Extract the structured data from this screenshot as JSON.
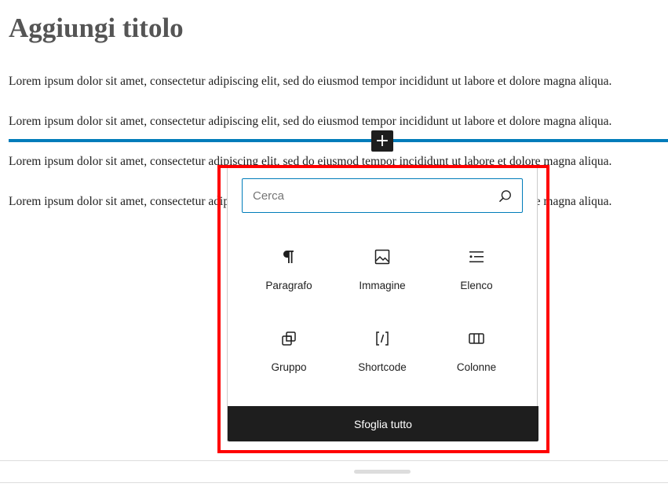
{
  "editor": {
    "title": "Aggiungi titolo",
    "paragraphs": [
      "Lorem ipsum dolor sit amet, consectetur adipiscing elit, sed do eiusmod tempor incididunt ut labore et dolore magna aliqua.",
      "Lorem ipsum dolor sit amet, consectetur adipiscing elit, sed do eiusmod tempor incididunt ut labore et dolore magna aliqua.",
      "Lorem ipsum dolor sit amet, consectetur adipiscing elit, sed do eiusmod tempor incididunt ut labore et dolore magna aliqua.",
      "Lorem ipsum dolor sit amet, consectetur adipiscing elit, sed do eiusmod tempor incididunt ut labore et dolore magna aliqua."
    ],
    "inserter_toggle": "+"
  },
  "inserter": {
    "search": {
      "placeholder": "Cerca",
      "value": ""
    },
    "blocks": [
      {
        "label": "Paragrafo",
        "icon": "paragraph-icon"
      },
      {
        "label": "Immagine",
        "icon": "image-icon"
      },
      {
        "label": "Elenco",
        "icon": "list-icon"
      },
      {
        "label": "Gruppo",
        "icon": "group-icon"
      },
      {
        "label": "Shortcode",
        "icon": "shortcode-icon"
      },
      {
        "label": "Colonne",
        "icon": "columns-icon"
      }
    ],
    "browse_all_label": "Sfoglia tutto"
  },
  "colors": {
    "accent": "#007cba",
    "highlight": "#ff0000",
    "dark": "#1e1e1e"
  }
}
